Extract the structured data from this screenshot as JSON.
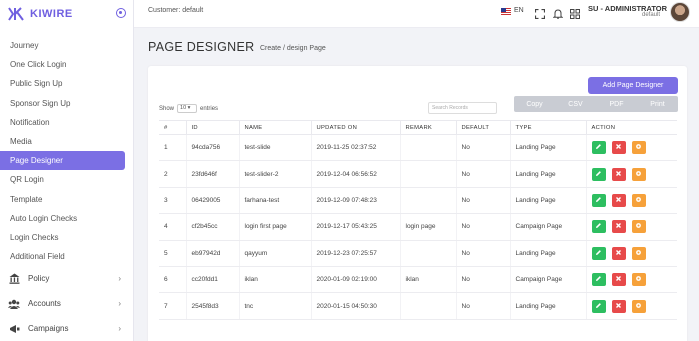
{
  "brand": {
    "name": "KIWIRE"
  },
  "sidebar": {
    "items": [
      {
        "label": "Journey"
      },
      {
        "label": "One Click Login"
      },
      {
        "label": "Public Sign Up"
      },
      {
        "label": "Sponsor Sign Up"
      },
      {
        "label": "Notification"
      },
      {
        "label": "Media"
      },
      {
        "label": "Page Designer",
        "active": true
      },
      {
        "label": "QR Login"
      },
      {
        "label": "Template"
      },
      {
        "label": "Auto Login Checks"
      },
      {
        "label": "Login Checks"
      },
      {
        "label": "Additional Field"
      }
    ],
    "groups": [
      {
        "label": "Policy",
        "icon": "bank-icon"
      },
      {
        "label": "Accounts",
        "icon": "users-icon"
      },
      {
        "label": "Campaigns",
        "icon": "campaign-icon"
      }
    ]
  },
  "topbar": {
    "customer": "Customer: default",
    "lang": "EN",
    "user_name": "SU - ADMINISTRATOR",
    "user_role": "default"
  },
  "page": {
    "title": "PAGE DESIGNER",
    "breadcrumb": "Create / design Page"
  },
  "card": {
    "add_label": "Add Page Designer",
    "show_label": "Show",
    "show_value": "10",
    "entries_label": "entries",
    "search_placeholder": "Search Records",
    "exports": [
      "Copy",
      "CSV",
      "PDF",
      "Print"
    ]
  },
  "table": {
    "headers": [
      "#",
      "ID",
      "NAME",
      "UPDATED ON",
      "REMARK",
      "DEFAULT",
      "TYPE",
      "ACTION"
    ],
    "rows": [
      [
        "1",
        "94cda756",
        "test-slide",
        "2019-11-25 02:37:52",
        "",
        "No",
        "Landing Page"
      ],
      [
        "2",
        "23fd646f",
        "test-slider-2",
        "2019-12-04 06:56:52",
        "",
        "No",
        "Landing Page"
      ],
      [
        "3",
        "06429005",
        "farhana-test",
        "2019-12-09 07:48:23",
        "",
        "No",
        "Landing Page"
      ],
      [
        "4",
        "cf2b45cc",
        "login first page",
        "2019-12-17 05:43:25",
        "login page",
        "No",
        "Campaign Page"
      ],
      [
        "5",
        "eb97942d",
        "qayyum",
        "2019-12-23 07:25:57",
        "",
        "No",
        "Landing Page"
      ],
      [
        "6",
        "cc20fdd1",
        "iklan",
        "2020-01-09 02:19:00",
        "iklan",
        "No",
        "Campaign Page"
      ],
      [
        "7",
        "2545f8d3",
        "tnc",
        "2020-01-15 04:50:30",
        "",
        "No",
        "Landing Page"
      ]
    ]
  },
  "colors": {
    "accent": "#7b6fe4",
    "edit": "#2dbe60",
    "delete": "#e74a4a",
    "settings": "#f6a13a"
  }
}
